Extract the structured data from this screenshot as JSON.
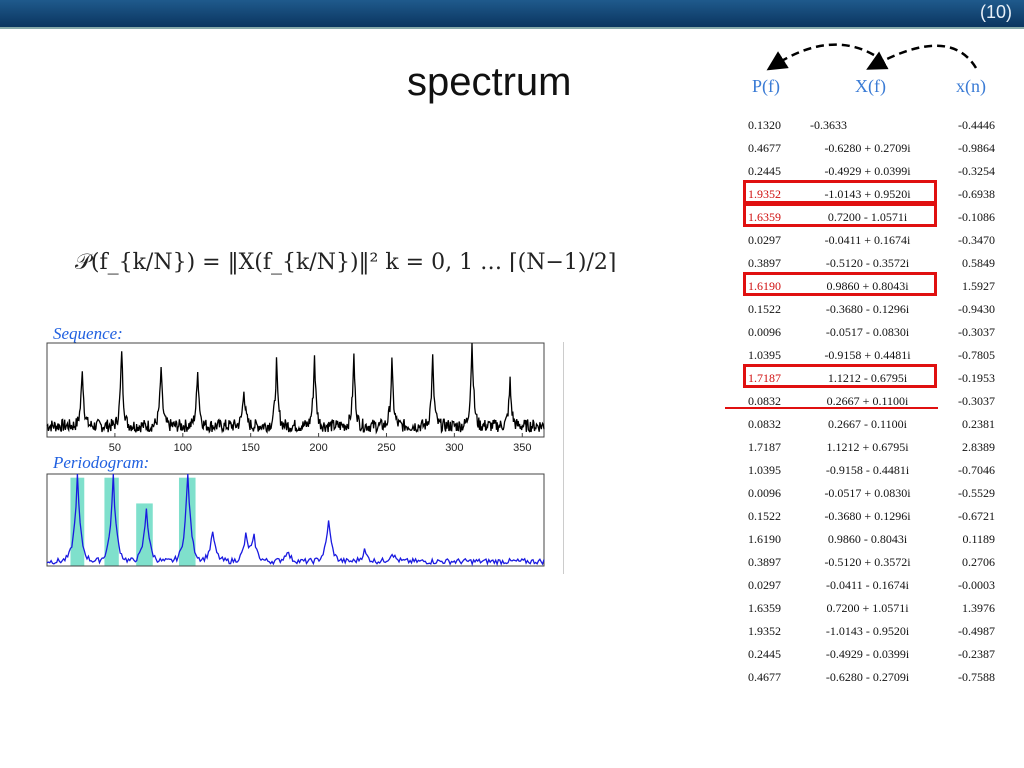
{
  "header": {
    "slide_number": "(10)"
  },
  "title": "spectrum",
  "columns": {
    "p": "P(f)",
    "x": "X(f)",
    "xn": "x(n)"
  },
  "rows": [
    {
      "p": "0.1320",
      "x": "-0.3633",
      "xn": "-0.4446"
    },
    {
      "p": "0.4677",
      "x": "-0.6280 + 0.2709i",
      "xn": "-0.9864"
    },
    {
      "p": "0.2445",
      "x": "-0.4929 + 0.0399i",
      "xn": "-0.3254"
    },
    {
      "p": "1.9352",
      "x": "-1.0143 + 0.9520i",
      "xn": "-0.6938",
      "hl": true
    },
    {
      "p": "1.6359",
      "x": "0.7200 - 1.0571i",
      "xn": "-0.1086",
      "hl": true
    },
    {
      "p": "0.0297",
      "x": "-0.0411 + 0.1674i",
      "xn": "-0.3470"
    },
    {
      "p": "0.3897",
      "x": "-0.5120 - 0.3572i",
      "xn": "0.5849"
    },
    {
      "p": "1.6190",
      "x": "0.9860 + 0.8043i",
      "xn": "1.5927",
      "hl": true
    },
    {
      "p": "0.1522",
      "x": "-0.3680 - 0.1296i",
      "xn": "-0.9430"
    },
    {
      "p": "0.0096",
      "x": "-0.0517 - 0.0830i",
      "xn": "-0.3037"
    },
    {
      "p": "1.0395",
      "x": "-0.9158 + 0.4481i",
      "xn": "-0.7805"
    },
    {
      "p": "1.7187",
      "x": "1.1212 - 0.6795i",
      "xn": "-0.1953",
      "hl": true
    },
    {
      "p": "0.0832",
      "x": "0.2667 + 0.1100i",
      "xn": "-0.3037"
    },
    {
      "p": "0.0832",
      "x": "0.2667 - 0.1100i",
      "xn": "0.2381"
    },
    {
      "p": "1.7187",
      "x": "1.1212 + 0.6795i",
      "xn": "2.8389"
    },
    {
      "p": "1.0395",
      "x": "-0.9158 - 0.4481i",
      "xn": "-0.7046"
    },
    {
      "p": "0.0096",
      "x": "-0.0517 + 0.0830i",
      "xn": "-0.5529"
    },
    {
      "p": "0.1522",
      "x": "-0.3680 + 0.1296i",
      "xn": "-0.6721"
    },
    {
      "p": "1.6190",
      "x": "0.9860 - 0.8043i",
      "xn": "0.1189"
    },
    {
      "p": "0.3897",
      "x": "-0.5120 + 0.3572i",
      "xn": "0.2706"
    },
    {
      "p": "0.0297",
      "x": "-0.0411 - 0.1674i",
      "xn": "-0.0003"
    },
    {
      "p": "1.6359",
      "x": "0.7200 + 1.0571i",
      "xn": "1.3976"
    },
    {
      "p": "1.9352",
      "x": "-1.0143 - 0.9520i",
      "xn": "-0.4987"
    },
    {
      "p": "0.2445",
      "x": "-0.4929 - 0.0399i",
      "xn": "-0.2387"
    },
    {
      "p": "0.4677",
      "x": "-0.6280 - 0.2709i",
      "xn": "-0.7588"
    }
  ],
  "formula": "𝒫(f_{k/N}) = ‖X(f_{k/N})‖²   k = 0, 1 … ⌈(N−1)/2⌉",
  "chart_data": [
    {
      "type": "line",
      "title": "Sequence:",
      "xlim": [
        0,
        366
      ],
      "xticks": [
        "50",
        "100",
        "150",
        "200",
        "250",
        "300",
        "350"
      ],
      "xtick_values": [
        50,
        100,
        150,
        200,
        250,
        300,
        350
      ],
      "peaks_x": [
        26,
        55,
        84,
        111,
        145,
        169,
        197,
        226,
        254,
        284,
        313,
        341
      ],
      "peaks_height": [
        0.63,
        0.83,
        0.63,
        0.63,
        0.42,
        0.68,
        0.76,
        0.75,
        0.68,
        0.73,
        1.0,
        0.48
      ],
      "color": "#000000"
    },
    {
      "type": "line",
      "title": "Periodogram:",
      "xlim": [
        0,
        180
      ],
      "peaks_x": [
        11,
        24,
        36,
        51,
        60,
        72,
        75,
        87,
        102,
        115,
        125
      ],
      "peaks_height": [
        0.94,
        0.94,
        0.59,
        1.0,
        0.33,
        0.27,
        0.25,
        0.12,
        0.46,
        0.12,
        0.1
      ],
      "highlight_ranges": [
        [
          8.5,
          13.5,
          0.96
        ],
        [
          20.8,
          26,
          0.96
        ],
        [
          32.3,
          38.3,
          0.68
        ],
        [
          47.8,
          53.8,
          0.96
        ]
      ],
      "color": "#1a1ae0",
      "highlight_color": "#7fe0cc"
    }
  ]
}
